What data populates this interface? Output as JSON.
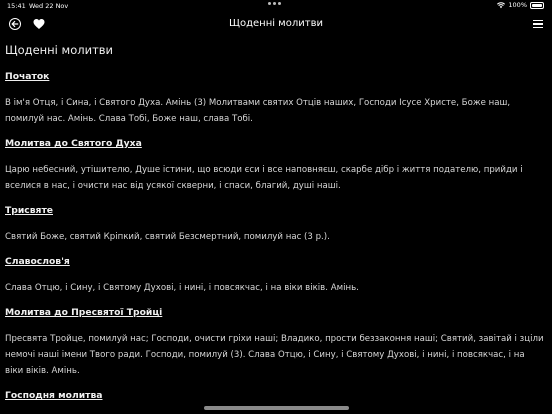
{
  "status": {
    "time": "15:41",
    "date": "Wed 22 Nov",
    "battery": "100%"
  },
  "nav": {
    "title": "Щоденні молитви"
  },
  "page_title": "Щоденні молитви",
  "sections": [
    {
      "title": "Початок",
      "text": "В ім'я Отця, і Сина, і Святого Духа. Амінь (3) Молитвами святих Отців наших, Господи Ісусе Христе, Боже наш, помилуй нас. Амінь. Слава Тобі, Боже наш, слава Тобі."
    },
    {
      "title": "Молитва до Святого Духа",
      "text": "Царю небесний, утішителю, Душе істини, що всюди єси і все наповняєш, скарбе дібр і життя подателю, прийди і вселися в нас, і очисти нас від усякої скверни, і спаси, благий, душі наші."
    },
    {
      "title": "Трисвяте",
      "text": "Святий Боже, святий Кріпкий, святий Безсмертний, помилуй нас (3 р.)."
    },
    {
      "title": "Славослов'я",
      "text": "Слава Отцю, і Сину, і Святому Духові, і нині, і повсякчас, і на віки віків. Амінь."
    },
    {
      "title": "Молитва до Пресвятої Тройці",
      "text": "Пресвята Тройце, помилуй нас; Господи, очисти гріхи наші; Владико, прости беззаконня наші; Святий, завітай і зціли немочі наші імени Твого ради. Господи, помилуй (3). Слава Отцю, і Сину, і Святому Духові, і нині, і повсякчас, і на віки віків. Амінь."
    },
    {
      "title": "Господня молитва",
      "text": ""
    }
  ]
}
